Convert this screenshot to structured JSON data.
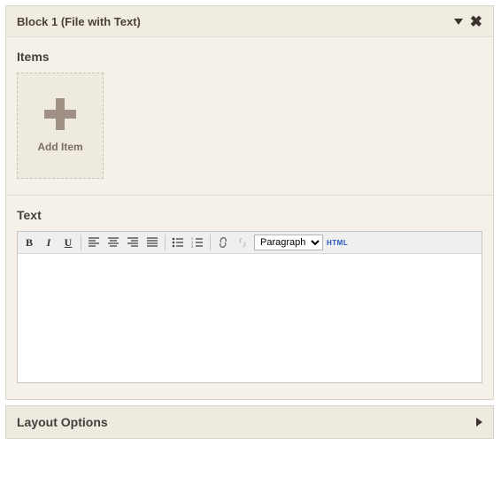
{
  "block": {
    "title": "Block 1 (File with Text)"
  },
  "items": {
    "heading": "Items",
    "add_label": "Add Item"
  },
  "text": {
    "heading": "Text",
    "format_selected": "Paragraph",
    "html_btn": "HTML",
    "content": ""
  },
  "layout": {
    "title": "Layout Options"
  }
}
